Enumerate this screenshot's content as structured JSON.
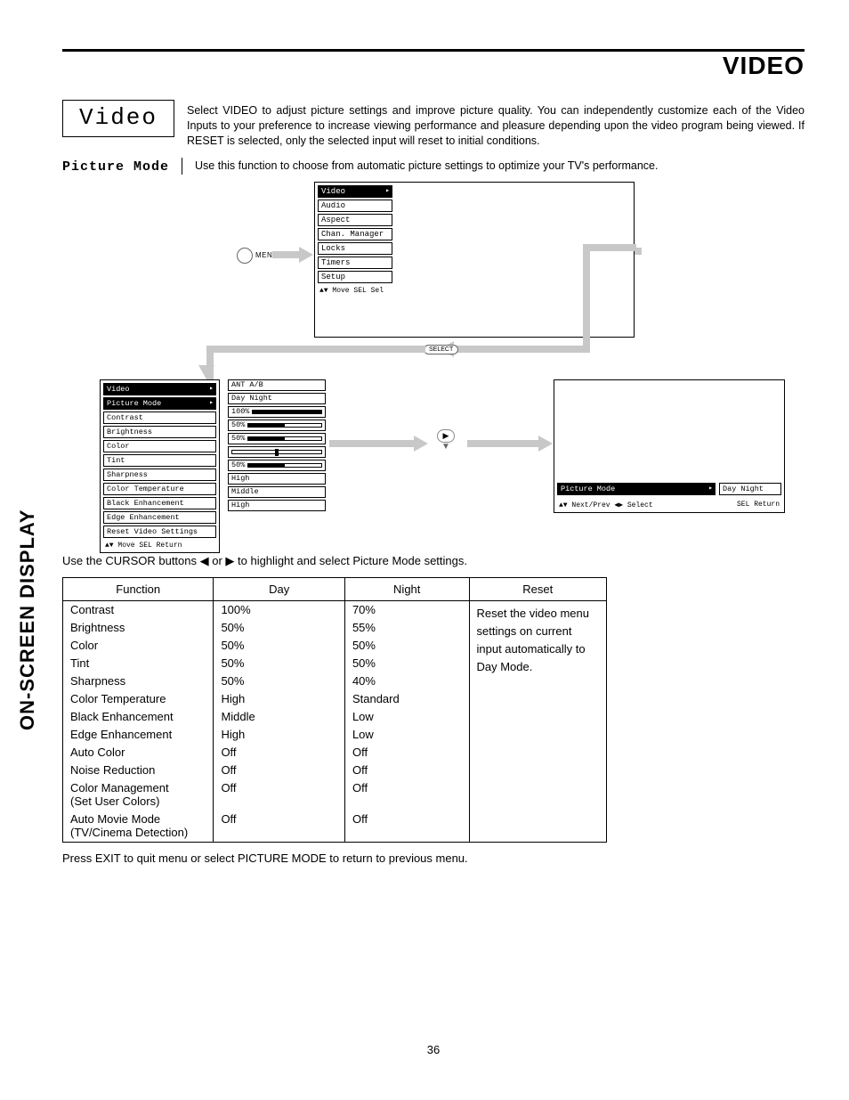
{
  "page_title": "VIDEO",
  "side_label": "ON-SCREEN DISPLAY",
  "page_number": "36",
  "video_box_label": "Video",
  "intro_text": "Select VIDEO to adjust picture settings and improve picture quality.  You can independently customize each of the Video Inputs to your preference to increase viewing performance and pleasure depending upon the video program being viewed.  If RESET is selected, only the selected input will reset to initial conditions.",
  "picture_mode_label": "Picture Mode",
  "picture_mode_text": "Use this function to choose from automatic picture settings to optimize your TV's performance.",
  "menu_button_label": "MENU",
  "select_button_label": "SELECT",
  "osd_main": {
    "items": [
      "Video",
      "Audio",
      "Aspect",
      "Chan. Manager",
      "Locks",
      "Timers",
      "Setup"
    ],
    "footer": "▲▼ Move  SEL Sel"
  },
  "osd_video": {
    "title": "Video",
    "items": [
      "Picture Mode",
      "Contrast",
      "Brightness",
      "Color",
      "Tint",
      "Sharpness",
      "Color Temperature",
      "Black Enhancement",
      "Edge Enhancement",
      "Reset Video Settings"
    ],
    "footer": "▲▼ Move  SEL Return"
  },
  "osd_values": {
    "source": "ANT A/B",
    "rows": [
      {
        "label": "Day      Night",
        "kind": "text"
      },
      {
        "label": "100%",
        "kind": "bar",
        "fill": 100
      },
      {
        "label": "50%",
        "kind": "bar",
        "fill": 50
      },
      {
        "label": "50%",
        "kind": "bar",
        "fill": 50
      },
      {
        "label": "",
        "kind": "tint"
      },
      {
        "label": "50%",
        "kind": "bar",
        "fill": 50
      },
      {
        "label": "High",
        "kind": "text"
      },
      {
        "label": "Middle",
        "kind": "text"
      },
      {
        "label": "High",
        "kind": "text"
      }
    ]
  },
  "osd_pm": {
    "label": "Picture Mode",
    "day_night": "Day  Night",
    "foot_left": "▲▼ Next/Prev  ◀▶ Select",
    "foot_right": "SEL Return"
  },
  "cursor_text": "Use the CURSOR buttons ◀ or ▶ to highlight and select Picture Mode settings.",
  "table": {
    "headers": [
      "Function",
      "Day",
      "Night",
      "Reset"
    ],
    "rows": [
      {
        "fn": "Contrast",
        "day": "100%",
        "night": "70%"
      },
      {
        "fn": "Brightness",
        "day": "50%",
        "night": "55%"
      },
      {
        "fn": "Color",
        "day": "50%",
        "night": "50%"
      },
      {
        "fn": "Tint",
        "day": "50%",
        "night": "50%"
      },
      {
        "fn": "Sharpness",
        "day": "50%",
        "night": "40%"
      },
      {
        "fn": "Color Temperature",
        "day": "High",
        "night": "Standard"
      },
      {
        "fn": "Black Enhancement",
        "day": "Middle",
        "night": "Low"
      },
      {
        "fn": "Edge Enhancement",
        "day": "High",
        "night": "Low"
      },
      {
        "fn": "Auto Color",
        "day": "Off",
        "night": "Off"
      },
      {
        "fn": "Noise Reduction",
        "day": "Off",
        "night": "Off"
      },
      {
        "fn": "Color Management (Set User Colors)",
        "day": "Off",
        "night": "Off"
      },
      {
        "fn": "Auto Movie Mode (TV/Cinema Detection)",
        "day": "Off",
        "night": "Off"
      }
    ],
    "reset_text": "Reset the video menu settings on current input automatically to Day Mode."
  },
  "exit_text": "Press EXIT to quit menu or select PICTURE MODE to return to previous menu."
}
